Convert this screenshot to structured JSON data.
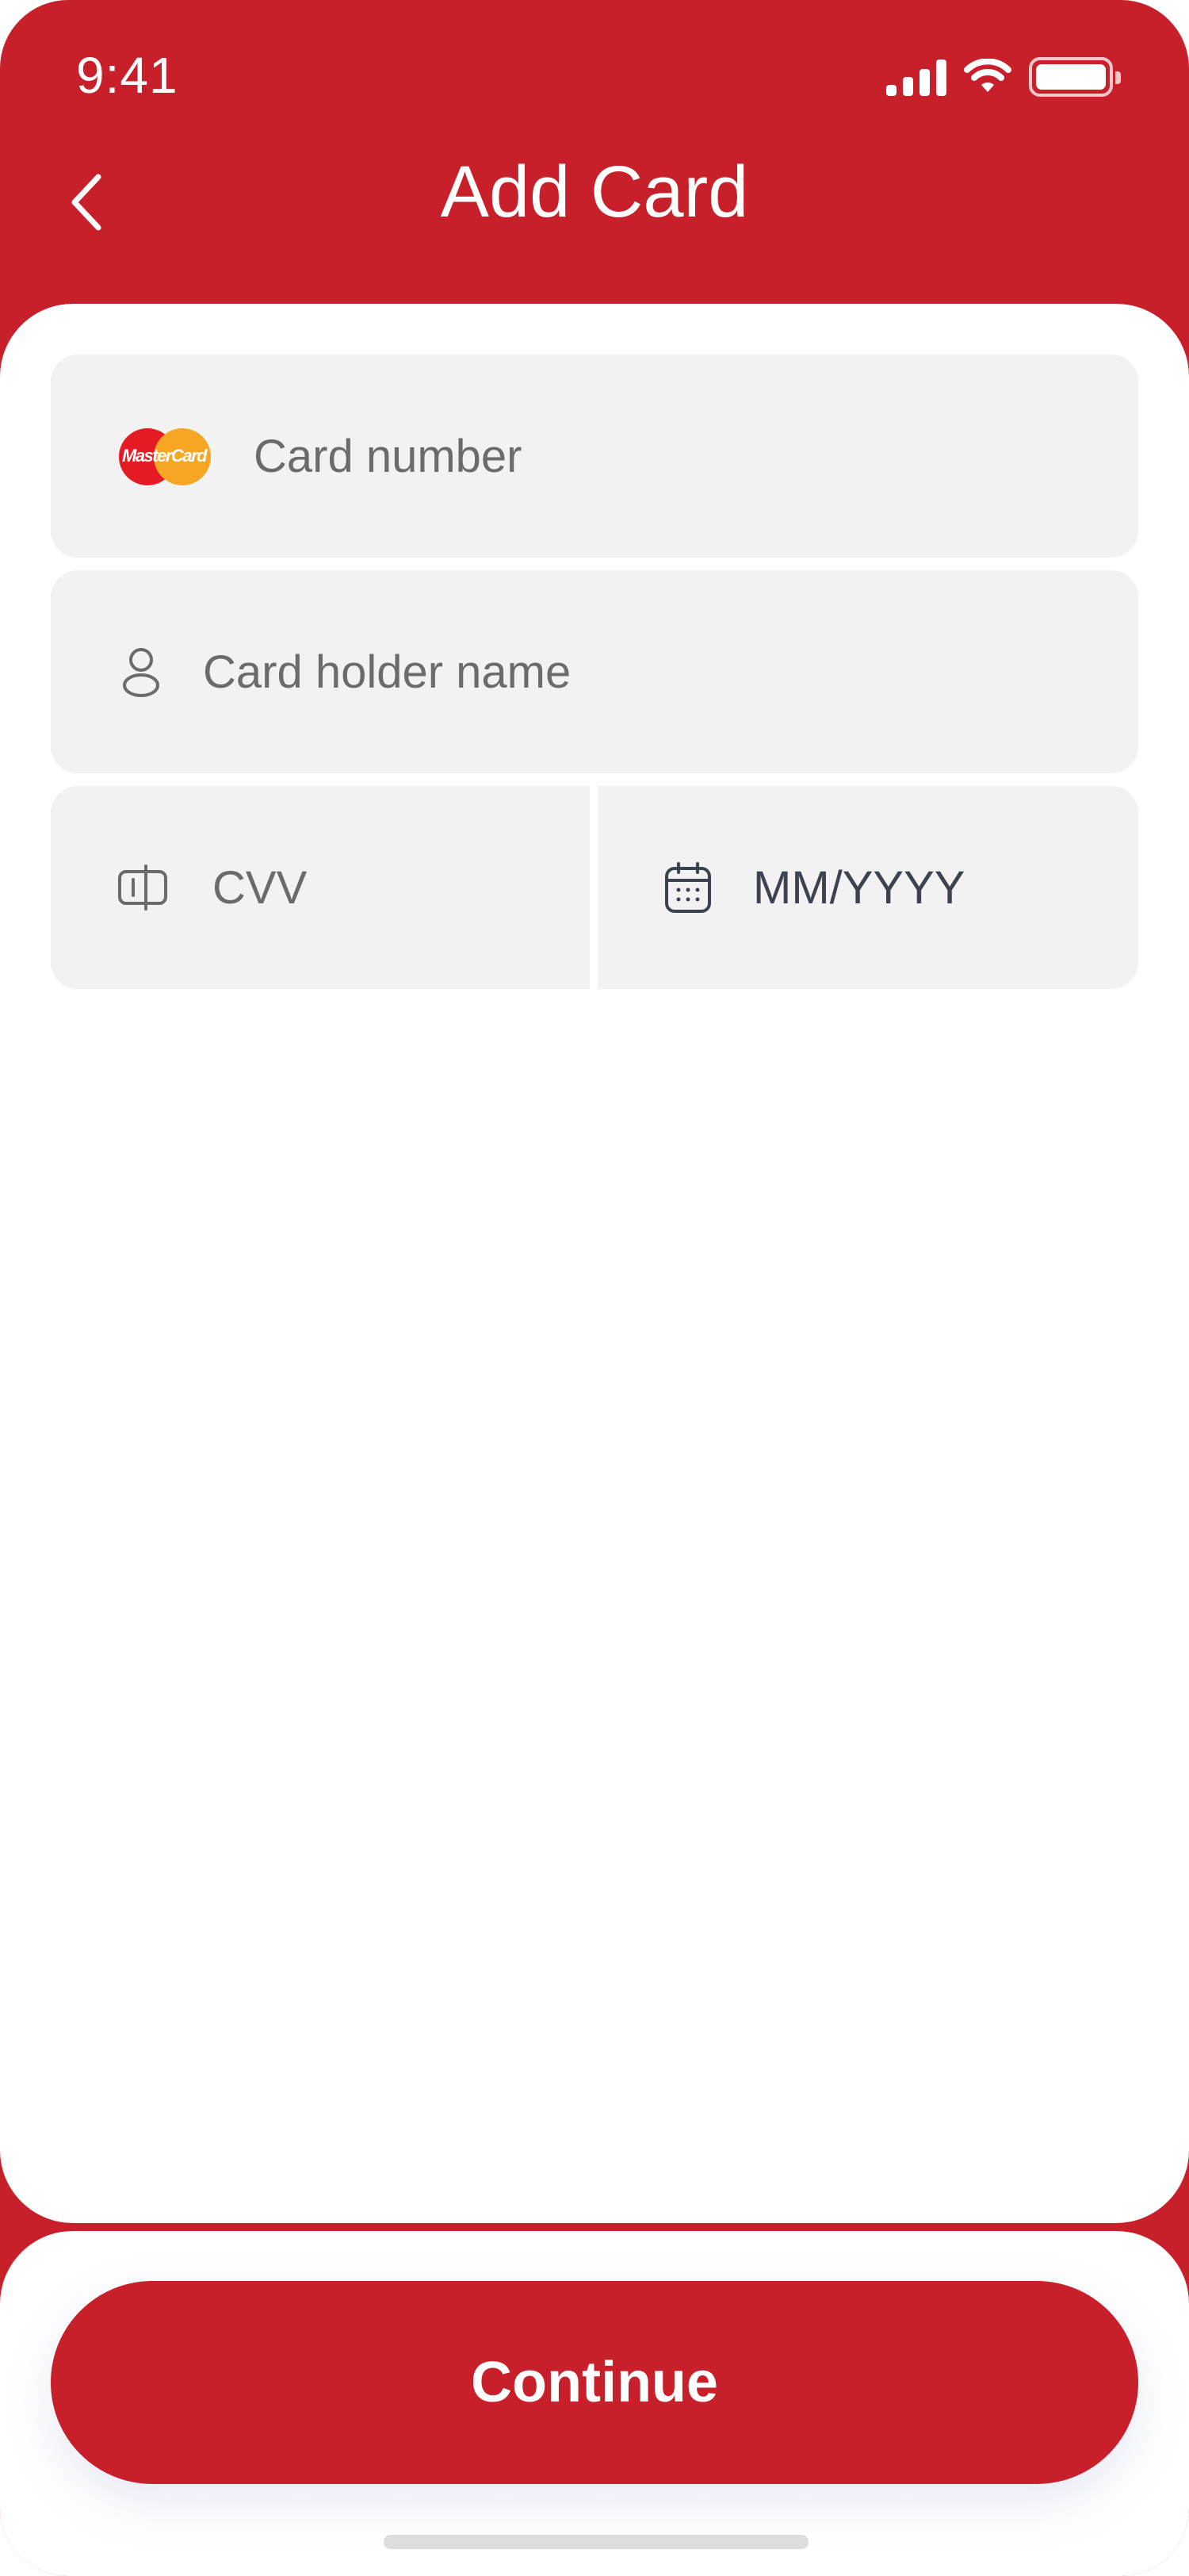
{
  "status_bar": {
    "time": "9:41"
  },
  "header": {
    "title": "Add Card"
  },
  "form": {
    "card_number": {
      "placeholder": "Card number"
    },
    "holder_name": {
      "placeholder": "Card holder name"
    },
    "cvv": {
      "placeholder": "CVV"
    },
    "expiry": {
      "placeholder": "MM/YYYY"
    }
  },
  "brand_logo_text": "MasterCard",
  "actions": {
    "continue_label": "Continue"
  },
  "colors": {
    "primary": "#c8202a",
    "field_bg": "#f2f2f2",
    "placeholder": "#6b6b6b"
  }
}
